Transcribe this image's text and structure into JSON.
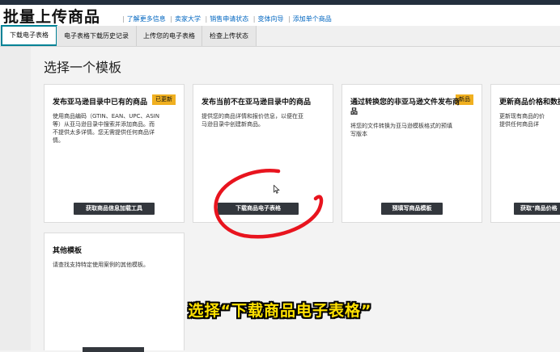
{
  "header": {
    "title": "批量上传商品",
    "links": [
      "了解更多信息",
      "卖家大学",
      "销售申请状态",
      "变体向导",
      "添加单个商品"
    ]
  },
  "tabs": [
    "下载电子表格",
    "电子表格下载历史记录",
    "上传您的电子表格",
    "检查上传状态"
  ],
  "section_title": "选择一个模板",
  "cards": [
    {
      "title": "发布亚马逊目录中已有的商品",
      "badge": "已更新",
      "desc": [
        "使用商品编码（GTIN、EAN、UPC、ASIN",
        "等）从亚马逊目录中搜索并添加商品。而",
        "不提供太多详情。您无需提供任何商品详",
        "情。"
      ],
      "button": "获取商品信息加载工具"
    },
    {
      "title": "发布当前不在亚马逊目录中的商品",
      "badge": "",
      "desc": [
        "提供您的商品详情和报价信息，以便在亚",
        "马逊目录中创建新商品。"
      ],
      "button": "下载商品电子表格"
    },
    {
      "title": "通过转换您的非亚马逊文件发布商",
      "title2": "品",
      "badge": "新品",
      "desc": [
        "将您的文件转换为亚马逊模板格式的预填",
        "写版本"
      ],
      "button": "预填写商品模板"
    },
    {
      "title": "更新商品价格和数据",
      "badge": "",
      "desc": [
        "更新现有商品的价",
        "提供任何商品详"
      ],
      "button": "获取\"商品价格"
    },
    {
      "title": "其他模板",
      "badge": "",
      "desc": [
        "请查找支持特定使用案例的其他模板。"
      ],
      "button": ""
    }
  ],
  "caption": "选择“下载商品电子表格”",
  "colors": {
    "accent": "#008296",
    "badge": "#f0b020",
    "annotation": "#e8141e",
    "caption": "#ffe100"
  }
}
